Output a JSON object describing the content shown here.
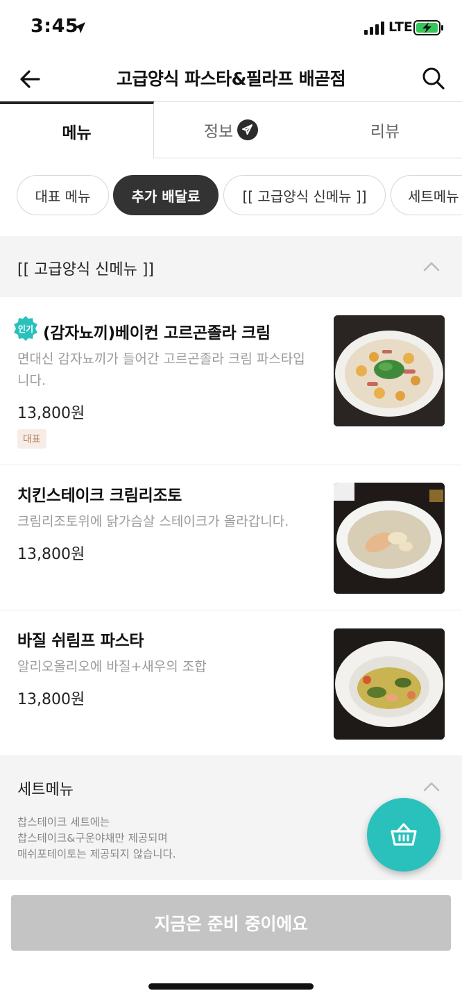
{
  "status_bar": {
    "time": "3:45",
    "network": "LTE"
  },
  "header": {
    "title": "고급양식 파스타&필라프 배곧점"
  },
  "tabs": [
    {
      "label": "메뉴"
    },
    {
      "label": "정보"
    },
    {
      "label": "리뷰"
    }
  ],
  "categories": [
    {
      "label": "대표 메뉴"
    },
    {
      "label": "추가 배달료"
    },
    {
      "label": "[[ 고급양식 신메뉴 ]]"
    },
    {
      "label": "세트메뉴"
    }
  ],
  "section": {
    "title": "[[ 고급양식 신메뉴 ]]"
  },
  "items": [
    {
      "badge": "인기",
      "name": "(감자뇨끼)베이컨 고르곤졸라 크림",
      "desc": "면대신 감자뇨끼가 들어간 고르곤졸라 크림 파스타입니다.",
      "price": "13,800원",
      "tag": "대표"
    },
    {
      "name": "치킨스테이크 크림리조토",
      "desc": "크림리조토위에 닭가슴살 스테이크가 올라갑니다.",
      "price": "13,800원"
    },
    {
      "name": "바질 쉬림프 파스타",
      "desc": "알리오올리오에 바질+새우의 조합",
      "price": "13,800원"
    }
  ],
  "set_menu": {
    "title": "세트메뉴",
    "note_lines": [
      "찹스테이크 세트에는",
      "찹스테이크&구운야채만 제공되며",
      "매쉬포테이토는 제공되지 않습니다."
    ]
  },
  "bottom": {
    "order_label": "지금은 준비 중이에요"
  },
  "colors": {
    "accent": "#2ac1bc",
    "chip_active": "#333333",
    "disabled": "#c4c4c4"
  }
}
